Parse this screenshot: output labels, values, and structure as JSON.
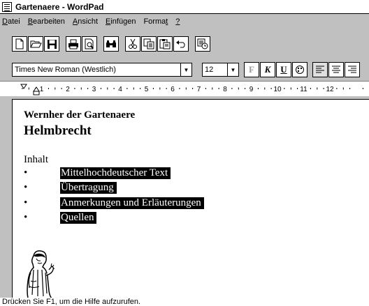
{
  "window": {
    "title": "Gartenaere - WordPad"
  },
  "menu": [
    {
      "underlined": "D",
      "rest": "atei"
    },
    {
      "underlined": "B",
      "rest": "earbeiten"
    },
    {
      "underlined": "A",
      "rest": "nsicht"
    },
    {
      "underlined": "E",
      "rest": "infügen"
    },
    {
      "prefix": "Forma",
      "underlined": "t",
      "rest": ""
    },
    {
      "underlined": "?",
      "rest": ""
    }
  ],
  "toolbar": {
    "icons": [
      "new-icon",
      "open-icon",
      "save-icon",
      "print-icon",
      "print-preview-icon",
      "find-icon",
      "cut-icon",
      "copy-icon",
      "paste-icon",
      "undo-icon",
      "datetime-icon"
    ]
  },
  "format": {
    "font": "Times New Roman (Westlich)",
    "size": "12",
    "bold": "F",
    "italic": "K",
    "underline": "U"
  },
  "ruler": {
    "numbers": [
      "1",
      "2",
      "3",
      "4",
      "5",
      "6",
      "7",
      "8",
      "9",
      "10",
      "11",
      "12"
    ]
  },
  "document": {
    "author": "Wernher der Gartenaere",
    "title": "Helmbrecht",
    "contents_label": "Inhalt",
    "bullet": "•",
    "toc": [
      "Mittelhochdeutscher Text",
      "Übertragung",
      "Anmerkungen und Erläuterungen",
      "Quellen"
    ]
  },
  "status": {
    "text": "Drücken Sie F1, um die Hilfe aufzurufen."
  }
}
